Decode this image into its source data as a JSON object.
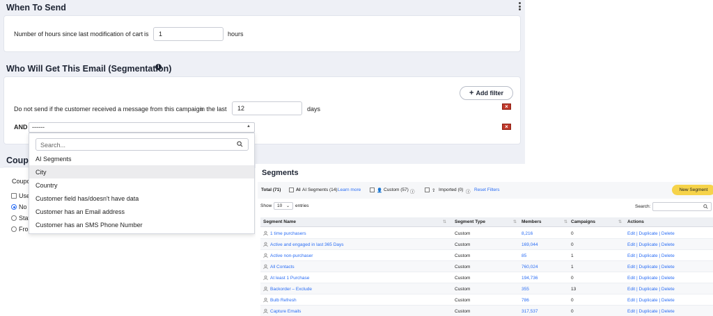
{
  "send": {
    "title": "When To Send",
    "hours_label": "Number of hours since last modification of cart",
    "is_label": "is",
    "hours_value": "1",
    "hours_unit": "hours"
  },
  "segmentation": {
    "title": "Who Will Get This Email (Segmentation)",
    "add_filter": "Add filter",
    "condition_label": "Do not send if the customer received a message from this campaign",
    "in_last": "in the last",
    "days_value": "12",
    "days_unit": "days",
    "and_label": "AND",
    "select_value": "------",
    "search_placeholder": "Search...",
    "options": [
      "AI Segments",
      "City",
      "Country",
      "Customer field has/doesn't have data",
      "Customer has an Email address",
      "Customer has an SMS Phone Number"
    ]
  },
  "coupon": {
    "title": "Coup",
    "sub": "Coupo",
    "use": "Use",
    "opt1": "No c",
    "opt2": "Stat",
    "opt3": "Fron"
  },
  "segments": {
    "title": "Segments",
    "total": "Total (71)",
    "ai_badge": "AI",
    "ai_label": "AI Segments (14)",
    "learn_more": "Learn more",
    "custom": "Custom (57)",
    "imported": "Imported (0)",
    "reset": "Reset Filters",
    "new_segment": "New Segment",
    "show": "Show",
    "show_value": "10",
    "entries": "entries",
    "search": "Search:",
    "columns": [
      "Segment Name",
      "Segment Type",
      "Members",
      "Campaigns",
      "Actions"
    ],
    "rows": [
      {
        "name": "1 time purchasers",
        "type": "Custom",
        "members": "8,216",
        "campaigns": "0"
      },
      {
        "name": "Active and engaged in last 365 Days",
        "type": "Custom",
        "members": "169,044",
        "campaigns": "0"
      },
      {
        "name": "Active non-purchaser",
        "type": "Custom",
        "members": "85",
        "campaigns": "1"
      },
      {
        "name": "All Contacts",
        "type": "Custom",
        "members": "760,024",
        "campaigns": "1"
      },
      {
        "name": "At least 1 Purchase",
        "type": "Custom",
        "members": "194,736",
        "campaigns": "0"
      },
      {
        "name": "Backorder – Exclude",
        "type": "Custom",
        "members": "355",
        "campaigns": "13"
      },
      {
        "name": "Bulb Refresh",
        "type": "Custom",
        "members": "786",
        "campaigns": "0"
      },
      {
        "name": "Capture Emails",
        "type": "Custom",
        "members": "317,537",
        "campaigns": "0"
      }
    ],
    "actions": "Edit | Duplicate | Delete"
  }
}
